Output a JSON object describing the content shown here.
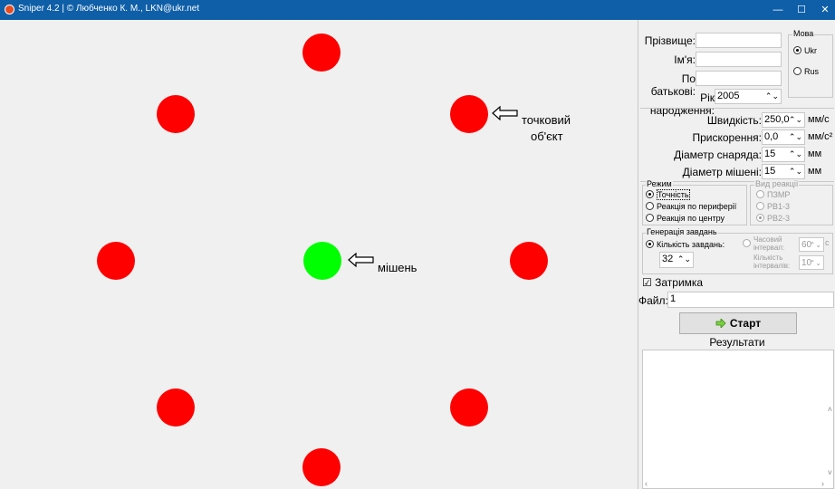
{
  "window": {
    "title": "Sniper 4.2 | © Любченко К. М., LKN@ukr.net",
    "minimize_glyph": "—",
    "maximize_glyph": "☐",
    "close_glyph": "✕"
  },
  "canvas": {
    "point_object_label_line1": "точковий",
    "point_object_label_line2": "об'єкт",
    "target_label": "мішень",
    "dot_color": "#ff0000",
    "target_color": "#00ff00"
  },
  "form": {
    "surname_label": "Прізвище:",
    "surname_value": "",
    "name_label": "Ім'я:",
    "name_value": "",
    "patronymic_label": "По батькові:",
    "patronymic_value": "",
    "birth_year_label": "Рік народження:",
    "birth_year_value": "2005",
    "language_group": "Мова",
    "lang_ukr": "Ukr",
    "lang_rus": "Rus",
    "lang_selected": "Ukr"
  },
  "params": {
    "speed_label": "Швидкість:",
    "speed_value": "250,0",
    "speed_unit": "мм/с",
    "accel_label": "Прискорення:",
    "accel_value": "0,0",
    "accel_unit": "мм/с²",
    "projectile_label": "Діаметр снаряда:",
    "projectile_value": "15",
    "projectile_unit": "мм",
    "target_label": "Діаметр мішені:",
    "target_value": "15",
    "target_unit": "мм"
  },
  "mode": {
    "group": "Режим",
    "accuracy": "Точність",
    "periphery": "Реакція по периферії",
    "center": "Реакція по центру"
  },
  "reaction": {
    "group": "Вид реакції",
    "pzmr": "ПЗМР",
    "rv13": "РВ1-3",
    "rv23": "РВ2-3"
  },
  "generation": {
    "group": "Генерація завдань",
    "count_label": "Кількість завдань:",
    "count_value": "32",
    "interval_label_line1": "Часовий",
    "interval_label_line2": "інтервал:",
    "interval_value": "60",
    "interval_unit": "с",
    "intervals_label_line1": "Кількість",
    "intervals_label_line2": "інтервалів:",
    "intervals_value": "10"
  },
  "delay_label": "Затримка",
  "delay_checked": "☑",
  "file_label": "Файл:",
  "file_value": "1",
  "start_button": "Старт",
  "results_label": "Результати",
  "spin_glyph": "⌃⌄"
}
